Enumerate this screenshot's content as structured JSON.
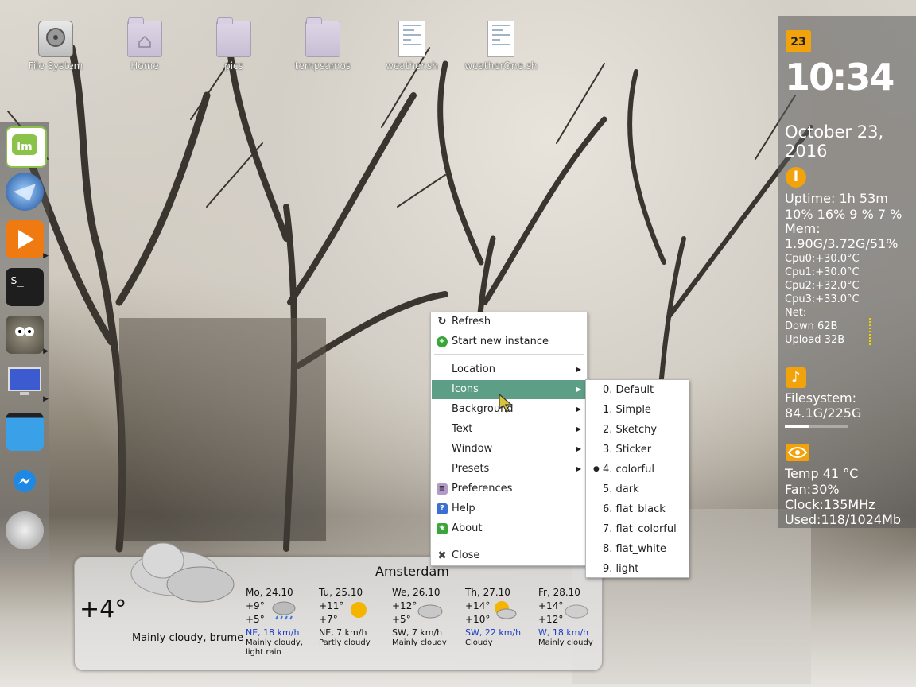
{
  "desktop_icons": [
    {
      "label": "File System",
      "icon": "harddisk-icon"
    },
    {
      "label": "Home",
      "icon": "home-folder-icon"
    },
    {
      "label": "pics",
      "icon": "folder-icon"
    },
    {
      "label": "tempsamos",
      "icon": "folder-icon"
    },
    {
      "label": "weather.sh",
      "icon": "script-file-icon"
    },
    {
      "label": "weatherOne.sh",
      "icon": "script-file-icon"
    }
  ],
  "dock_items": [
    {
      "name": "linux-mint-menu",
      "icon": "mint-logo-icon",
      "color": "#8bc34a"
    },
    {
      "name": "thunderbird",
      "icon": "mail-icon",
      "color": "#2a6fb5"
    },
    {
      "name": "media-player",
      "icon": "play-icon",
      "color": "#f07a12"
    },
    {
      "name": "terminal",
      "icon": "terminal-icon",
      "color": "#222222"
    },
    {
      "name": "gimp",
      "icon": "gimp-icon",
      "color": "#6e6a5a"
    },
    {
      "name": "display-settings",
      "icon": "monitor-icon",
      "color": "#3c5bd0"
    },
    {
      "name": "file-manager",
      "icon": "window-icon",
      "color": "#3aa0e8"
    },
    {
      "name": "messenger",
      "icon": "messenger-icon",
      "color": "#1e88e5"
    },
    {
      "name": "weather-app",
      "icon": "cloud-icon",
      "color": "#d0d0d0"
    }
  ],
  "conky": {
    "time": "10:34",
    "date": "October 23,\n2016",
    "uptime": "Uptime: 1h 53m",
    "cpu_percent": " 10% 16% 9 % 7 %",
    "mem_label": "Mem:",
    "mem_value": "1.90G/3.72G/51%",
    "cpu0": "Cpu0:+30.0°C",
    "cpu1": "Cpu1:+30.0°C",
    "cpu2": "Cpu2:+32.0°C",
    "cpu3": "Cpu3:+33.0°C",
    "net_label": "Net:",
    "down": "Down 62B",
    "upload": "Upload 32B",
    "fs_label": "Filesystem:",
    "fs_value": "84.1G/225G",
    "fs_fill_fraction": 0.37,
    "gpu_temp": "Temp 41 °C",
    "gpu_fan": "Fan:30%",
    "gpu_clock": "Clock:135MHz",
    "gpu_used": "Used:118/1024Mb"
  },
  "context_menu": {
    "refresh": "Refresh",
    "start_new": "Start new instance",
    "location": "Location",
    "icons": "Icons",
    "background": "Background",
    "text": "Text",
    "window": "Window",
    "presets": "Presets",
    "preferences": "Preferences",
    "help": "Help",
    "about": "About",
    "close": "Close"
  },
  "icons_submenu": {
    "items": [
      "0. Default",
      "1. Simple",
      "2. Sketchy",
      "3. Sticker",
      "4. colorful",
      "5. dark",
      "6. flat_black",
      "7. flat_colorful",
      "8. flat_white",
      "9. light"
    ],
    "selected_index": 4
  },
  "weather": {
    "city": "Amsterdam",
    "current_temp": "+4°",
    "current_desc": "Mainly cloudy, brume",
    "days": [
      {
        "day": "Mo, 24.10",
        "hi": "+9°",
        "lo": "+5°",
        "wind": "NE, 18 km/h",
        "wind_blue": true,
        "cond": "Mainly cloudy,\nlight rain",
        "icon": "rain-cloud-icon"
      },
      {
        "day": "Tu, 25.10",
        "hi": "+11°",
        "lo": "+7°",
        "wind": "NE, 7 km/h",
        "wind_blue": false,
        "cond": "Partly cloudy",
        "icon": "partly-cloudy-icon"
      },
      {
        "day": "We, 26.10",
        "hi": "+12°",
        "lo": "+5°",
        "wind": "SW, 7 km/h",
        "wind_blue": false,
        "cond": "Mainly cloudy",
        "icon": "cloud-icon"
      },
      {
        "day": "Th, 27.10",
        "hi": "+14°",
        "lo": "+10°",
        "wind": "SW, 22 km/h",
        "wind_blue": true,
        "cond": "Cloudy",
        "icon": "partly-cloudy-icon"
      },
      {
        "day": "Fr, 28.10",
        "hi": "+14°",
        "lo": "+12°",
        "wind": "W, 18 km/h",
        "wind_blue": true,
        "cond": "Mainly cloudy",
        "icon": "cloud-icon"
      }
    ]
  }
}
